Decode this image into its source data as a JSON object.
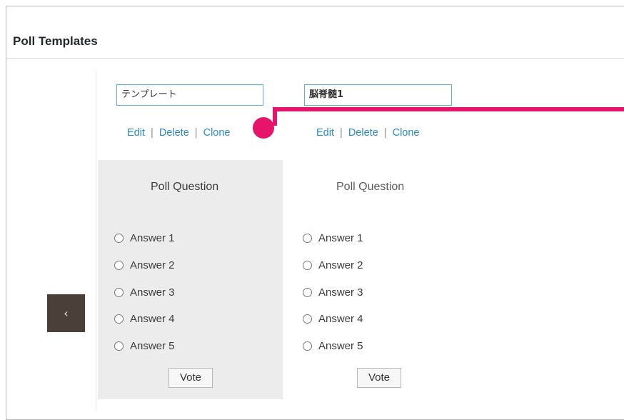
{
  "panel": {
    "title": "Poll Templates"
  },
  "nav": {
    "prev_label": "‹"
  },
  "templates": [
    {
      "name": "テンプレート",
      "actions": {
        "edit": "Edit",
        "delete": "Delete",
        "clone": "Clone",
        "separator": "|"
      },
      "question": "Poll Question",
      "answers": [
        "Answer 1",
        "Answer 2",
        "Answer 3",
        "Answer 4",
        "Answer 5"
      ],
      "vote_label": "Vote"
    },
    {
      "name": "脳脊髄1",
      "actions": {
        "edit": "Edit",
        "delete": "Delete",
        "clone": "Clone",
        "separator": "|"
      },
      "question": "Poll Question",
      "answers": [
        "Answer 1",
        "Answer 2",
        "Answer 3",
        "Answer 4",
        "Answer 5"
      ],
      "vote_label": "Vote"
    }
  ],
  "colors": {
    "accent_callout": "#e6156b",
    "link": "#2b89c7",
    "input_border": "#5aaed9",
    "nav_button": "#4a4039"
  },
  "icons": {
    "prev": "chevron-left-icon",
    "radio": "radio-icon"
  }
}
